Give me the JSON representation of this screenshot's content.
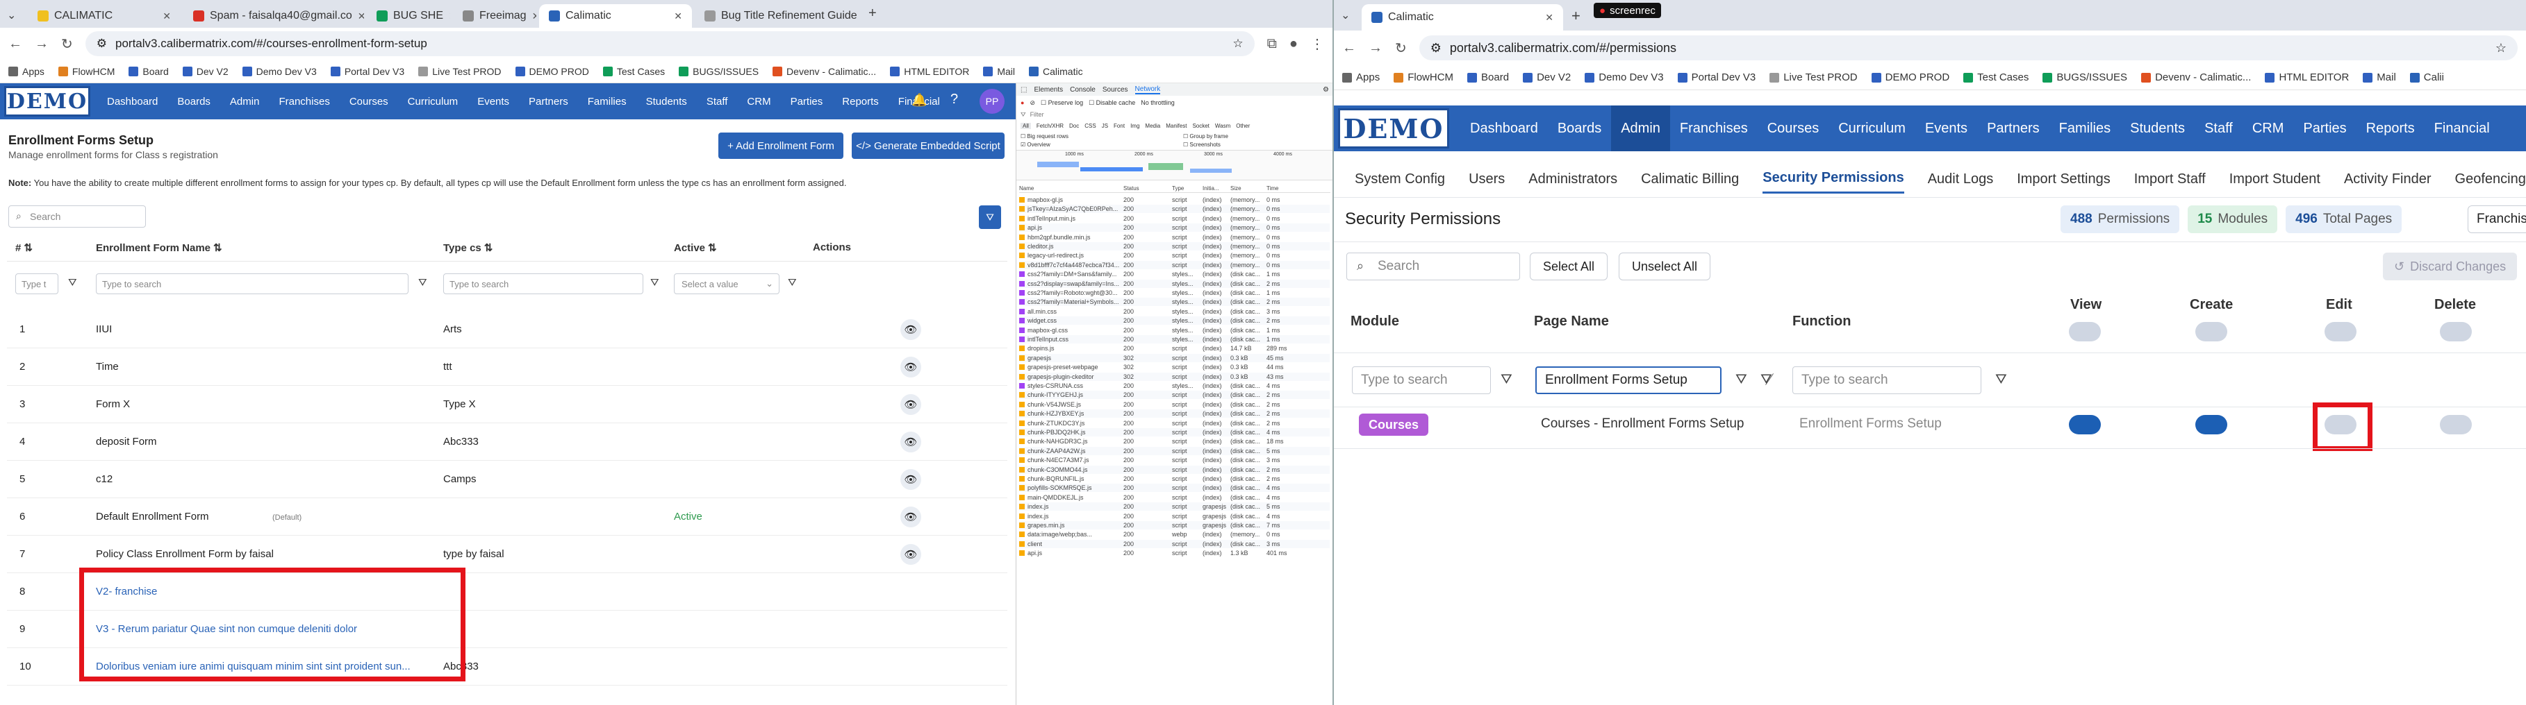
{
  "left_browser": {
    "tabs": [
      {
        "label": "CALIMATIC",
        "color": "#f0c020"
      },
      {
        "label": "Spam - faisalqa40@gmail.co",
        "color": "#d93025"
      },
      {
        "label": "BUG SHE",
        "color": "#0f9d58"
      },
      {
        "label": "Freeimag",
        "color": "#888888"
      },
      {
        "label": "Calimatic",
        "color": "#2a63b7"
      },
      {
        "label": "Bug Title Refinement Guide",
        "color": "#999999"
      }
    ],
    "url": "portalv3.calibermatrix.com/#/courses-enrollment-form-setup",
    "bookmarks": [
      "Apps",
      "FlowHCM",
      "Board",
      "Dev V2",
      "Demo Dev V3",
      "Portal Dev V3",
      "Live Test PROD",
      "DEMO PROD",
      "Test Cases",
      "BUGS/ISSUES",
      "Devenv - Calimatic...",
      "HTML EDITOR",
      "Mail",
      "Calimatic"
    ]
  },
  "left_app": {
    "logo": "DEMO",
    "nav": [
      "Dashboard",
      "Boards",
      "Admin",
      "Franchises",
      "Courses",
      "Curriculum",
      "Events",
      "Partners",
      "Families",
      "Students",
      "Staff",
      "CRM",
      "Parties",
      "Reports",
      "Financial"
    ],
    "avatar": "PP",
    "title": "Enrollment Forms Setup",
    "subtitle": "Manage enrollment forms for Class s registration",
    "add_button": "+ Add Enrollment Form",
    "embed_button": "</> Generate Embedded Script",
    "note_label": "Note:",
    "note_text": "You have the ability to create multiple different enrollment forms to assign for your types cp. By default, all types cp will use the Default Enrollment form unless the type cs has an enrollment form assigned.",
    "search_placeholder": "Search",
    "columns": [
      "#",
      "Enrollment Form Name",
      "Type cs",
      "Active",
      "Actions"
    ],
    "filters": {
      "num": "Type t",
      "name": "Type to search",
      "type": "Type to search",
      "active": "Select a value"
    },
    "rows": [
      {
        "num": "1",
        "name": "IIUI",
        "tag": "",
        "type": "Arts",
        "active": "",
        "link": false,
        "eye": true
      },
      {
        "num": "2",
        "name": "Time",
        "tag": "",
        "type": "ttt",
        "active": "",
        "link": false,
        "eye": true
      },
      {
        "num": "3",
        "name": "Form X",
        "tag": "",
        "type": "Type X",
        "active": "",
        "link": false,
        "eye": true
      },
      {
        "num": "4",
        "name": "deposit Form",
        "tag": "",
        "type": "Abc333",
        "active": "",
        "link": false,
        "eye": true
      },
      {
        "num": "5",
        "name": "c12",
        "tag": "",
        "type": "Camps",
        "active": "",
        "link": false,
        "eye": true
      },
      {
        "num": "6",
        "name": "Default Enrollment Form",
        "tag": "(Default)",
        "type": "",
        "active": "Active",
        "link": false,
        "eye": true
      },
      {
        "num": "7",
        "name": "Policy Class Enrollment Form by faisal",
        "tag": "",
        "type": "type by faisal",
        "active": "",
        "link": false,
        "eye": true
      },
      {
        "num": "8",
        "name": "V2- franchise",
        "tag": "",
        "type": "",
        "active": "",
        "link": true,
        "eye": false
      },
      {
        "num": "9",
        "name": "V3 - Rerum pariatur Quae sint non cumque deleniti dolor",
        "tag": "",
        "type": "",
        "active": "",
        "link": true,
        "eye": false
      },
      {
        "num": "10",
        "name": "Doloribus veniam iure animi quisquam minim sint sint proident sun...",
        "tag": "",
        "type": "Abc333",
        "active": "",
        "link": true,
        "eye": false
      }
    ]
  },
  "devtools": {
    "tabs": [
      "Elements",
      "Console",
      "Sources",
      "Network"
    ],
    "toolbar": [
      "Preserve log",
      "Disable cache",
      "No throttling"
    ],
    "filter_label": "Filter",
    "types": [
      "All",
      "Fetch/XHR",
      "Doc",
      "CSS",
      "JS",
      "Font",
      "Img",
      "Media",
      "Manifest",
      "Socket",
      "Wasm",
      "Other"
    ],
    "options": [
      "Big request rows",
      "Group by frame",
      "Overview",
      "Screenshots"
    ],
    "timeline": [
      "1000 ms",
      "2000 ms",
      "3000 ms",
      "4000 ms"
    ],
    "columns": [
      "Name",
      "Status",
      "Type",
      "Initia...",
      "Size",
      "Time"
    ],
    "requests": [
      [
        "mapbox-gl.js",
        "200",
        "script",
        "(index)",
        "(memory...",
        "0 ms"
      ],
      [
        "jsTkey=AIzaSyAC7QbE0RPeh...",
        "200",
        "script",
        "(index)",
        "(memory...",
        "0 ms"
      ],
      [
        "intlTelInput.min.js",
        "200",
        "script",
        "(index)",
        "(memory...",
        "0 ms"
      ],
      [
        "api.js",
        "200",
        "script",
        "(index)",
        "(memory...",
        "0 ms"
      ],
      [
        "hbm2qpf.bundle.min.js",
        "200",
        "script",
        "(index)",
        "(memory...",
        "0 ms"
      ],
      [
        "cleditor.js",
        "200",
        "script",
        "(index)",
        "(memory...",
        "0 ms"
      ],
      [
        "legacy-url-redirect.js",
        "200",
        "script",
        "(index)",
        "(memory...",
        "0 ms"
      ],
      [
        "v8d1bfff7c7cf4a4487ecbca7f34...",
        "200",
        "script",
        "(index)",
        "(memory...",
        "0 ms"
      ],
      [
        "css2?family=DM+Sans&family...",
        "200",
        "styles...",
        "(index)",
        "(disk cac...",
        "1 ms"
      ],
      [
        "css2?display=swap&family=Ins...",
        "200",
        "styles...",
        "(index)",
        "(disk cac...",
        "2 ms"
      ],
      [
        "css2?family=Roboto:wght@30...",
        "200",
        "styles...",
        "(index)",
        "(disk cac...",
        "1 ms"
      ],
      [
        "css2?family=Material+Symbols...",
        "200",
        "styles...",
        "(index)",
        "(disk cac...",
        "2 ms"
      ],
      [
        "all.min.css",
        "200",
        "styles...",
        "(index)",
        "(disk cac...",
        "3 ms"
      ],
      [
        "widget.css",
        "200",
        "styles...",
        "(index)",
        "(disk cac...",
        "2 ms"
      ],
      [
        "mapbox-gl.css",
        "200",
        "styles...",
        "(index)",
        "(disk cac...",
        "1 ms"
      ],
      [
        "intlTelInput.css",
        "200",
        "styles...",
        "(index)",
        "(disk cac...",
        "1 ms"
      ],
      [
        "dropins.js",
        "200",
        "script",
        "(index)",
        "14.7 kB",
        "289 ms"
      ],
      [
        "grapesjs",
        "302",
        "script",
        "(index)",
        "0.3 kB",
        "45 ms"
      ],
      [
        "grapesjs-preset-webpage",
        "302",
        "script",
        "(index)",
        "0.3 kB",
        "44 ms"
      ],
      [
        "grapesjs-plugin-ckeditor",
        "302",
        "script",
        "(index)",
        "0.3 kB",
        "43 ms"
      ],
      [
        "styles-CSRUNA.css",
        "200",
        "styles...",
        "(index)",
        "(disk cac...",
        "4 ms"
      ],
      [
        "chunk-ITYYGEHJ.js",
        "200",
        "script",
        "(index)",
        "(disk cac...",
        "2 ms"
      ],
      [
        "chunk-V54JWSE.js",
        "200",
        "script",
        "(index)",
        "(disk cac...",
        "2 ms"
      ],
      [
        "chunk-HZJYBXEY.js",
        "200",
        "script",
        "(index)",
        "(disk cac...",
        "2 ms"
      ],
      [
        "chunk-ZTUKDC3Y.js",
        "200",
        "script",
        "(index)",
        "(disk cac...",
        "2 ms"
      ],
      [
        "chunk-PBJDQ2HK.js",
        "200",
        "script",
        "(index)",
        "(disk cac...",
        "4 ms"
      ],
      [
        "chunk-NAHGDR3C.js",
        "200",
        "script",
        "(index)",
        "(disk cac...",
        "18 ms"
      ],
      [
        "chunk-ZAAP4A2W.js",
        "200",
        "script",
        "(index)",
        "(disk cac...",
        "5 ms"
      ],
      [
        "chunk-N4EC7A3M7.js",
        "200",
        "script",
        "(index)",
        "(disk cac...",
        "3 ms"
      ],
      [
        "chunk-C3OMMO44.js",
        "200",
        "script",
        "(index)",
        "(disk cac...",
        "2 ms"
      ],
      [
        "chunk-BQRUNFIL.js",
        "200",
        "script",
        "(index)",
        "(disk cac...",
        "2 ms"
      ],
      [
        "polyfills-SOKMR5QE.js",
        "200",
        "script",
        "(index)",
        "(disk cac...",
        "4 ms"
      ],
      [
        "main-QMDDKEJL.js",
        "200",
        "script",
        "(index)",
        "(disk cac...",
        "4 ms"
      ],
      [
        "index.js",
        "200",
        "script",
        "grapesjs",
        "(disk cac...",
        "5 ms"
      ],
      [
        "index.js",
        "200",
        "script",
        "grapesjs",
        "(disk cac...",
        "4 ms"
      ],
      [
        "grapes.min.js",
        "200",
        "script",
        "grapesjs",
        "(disk cac...",
        "7 ms"
      ],
      [
        "data:image/webp;bas...",
        "200",
        "webp",
        "(index)",
        "(memory...",
        "0 ms"
      ],
      [
        "client",
        "200",
        "script",
        "(index)",
        "(disk cac...",
        "3 ms"
      ],
      [
        "api.js",
        "200",
        "script",
        "(index)",
        "1.3 kB",
        "401 ms"
      ]
    ]
  },
  "right_browser": {
    "tab": "Calimatic",
    "recorder": "screenrec",
    "url": "portalv3.calibermatrix.com/#/permissions",
    "bookmarks": [
      "Apps",
      "FlowHCM",
      "Board",
      "Dev V2",
      "Demo Dev V3",
      "Portal Dev V3",
      "Live Test PROD",
      "DEMO PROD",
      "Test Cases",
      "BUGS/ISSUES",
      "Devenv - Calimatic...",
      "HTML EDITOR",
      "Mail",
      "Calii"
    ]
  },
  "right_app": {
    "logo": "DEMO",
    "nav": [
      "Dashboard",
      "Boards",
      "Admin",
      "Franchises",
      "Courses",
      "Curriculum",
      "Events",
      "Partners",
      "Families",
      "Students",
      "Staff",
      "CRM",
      "Parties",
      "Reports",
      "Financial"
    ],
    "active_nav": "Admin",
    "subtabs": [
      "System Config",
      "Users",
      "Administrators",
      "Calimatic Billing",
      "Security Permissions",
      "Audit Logs",
      "Import Settings",
      "Import Staff",
      "Import Student",
      "Activity Finder",
      "Geofencing"
    ],
    "active_subtab": "Security Permissions",
    "title": "Security Permissions",
    "stats": [
      {
        "value": "488",
        "label": "Permissions",
        "bg": "#e6eef9",
        "fg": "#1c4e98"
      },
      {
        "value": "15",
        "label": "Modules",
        "bg": "#dff3e6",
        "fg": "#1e8a4a"
      },
      {
        "value": "496",
        "label": "Total Pages",
        "bg": "#e6eef9",
        "fg": "#1c4e98"
      }
    ],
    "franchise_button": "Franchis",
    "search_placeholder": "Search",
    "select_all": "Select All",
    "unselect_all": "Unselect All",
    "discard": "Discard Changes",
    "columns": [
      "Module",
      "Page Name",
      "Function",
      "View",
      "Create",
      "Edit",
      "Delete"
    ],
    "module_filter_placeholder": "Type to search",
    "page_filter_value": "Enrollment Forms Setup",
    "function_filter_placeholder": "Type to search",
    "row": {
      "module": "Courses",
      "page": "Courses - Enrollment Forms Setup",
      "function": "Enrollment Forms Setup",
      "view": true,
      "create": true,
      "edit": false,
      "delete": false
    },
    "colors": {
      "accent": "#2a63b7",
      "module_badge": "#b05ad6",
      "highlight": "#e4141b"
    }
  }
}
